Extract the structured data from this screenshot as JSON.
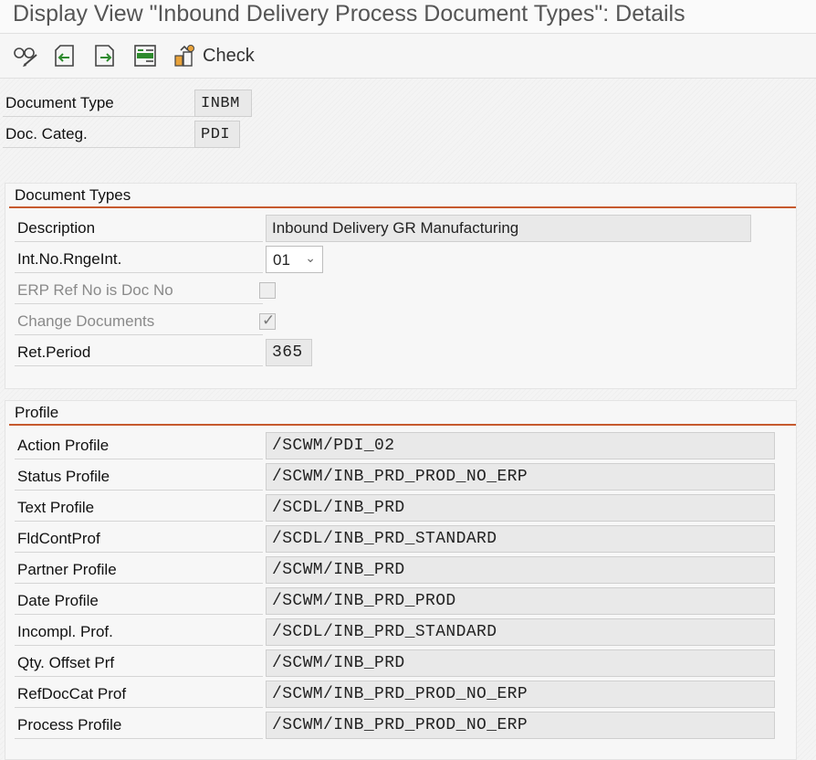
{
  "window": {
    "title": "Display View \"Inbound Delivery Process Document Types\": Details"
  },
  "toolbar": {
    "check_label": "Check",
    "icons": [
      "display-change-icon",
      "previous-entry-icon",
      "next-entry-icon",
      "select-block-icon",
      "check-icon"
    ]
  },
  "header": {
    "document_type": {
      "label": "Document Type",
      "value": "INBM"
    },
    "doc_categ": {
      "label": "Doc. Categ.",
      "value": "PDI"
    }
  },
  "document_types": {
    "title": "Document Types",
    "description": {
      "label": "Description",
      "value": "Inbound Delivery GR Manufacturing"
    },
    "int_no_range": {
      "label": "Int.No.RngeInt.",
      "value": "01"
    },
    "erp_ref": {
      "label": "ERP Ref No is Doc No",
      "checked": false
    },
    "change_docs": {
      "label": "Change Documents",
      "checked": true
    },
    "ret_period": {
      "label": "Ret.Period",
      "value": "365"
    }
  },
  "profile": {
    "title": "Profile",
    "rows": [
      {
        "label": "Action Profile",
        "value": "/SCWM/PDI_02"
      },
      {
        "label": "Status Profile",
        "value": "/SCWM/INB_PRD_PROD_NO_ERP"
      },
      {
        "label": "Text Profile",
        "value": "/SCDL/INB_PRD"
      },
      {
        "label": "FldContProf",
        "value": "/SCDL/INB_PRD_STANDARD"
      },
      {
        "label": "Partner Profile",
        "value": "/SCWM/INB_PRD"
      },
      {
        "label": "Date Profile",
        "value": "/SCWM/INB_PRD_PROD"
      },
      {
        "label": "Incompl. Prof.",
        "value": "/SCDL/INB_PRD_STANDARD"
      },
      {
        "label": "Qty. Offset Prf",
        "value": "/SCWM/INB_PRD"
      },
      {
        "label": "RefDocCat Prof",
        "value": "/SCWM/INB_PRD_PROD_NO_ERP"
      },
      {
        "label": "Process Profile",
        "value": "/SCWM/INB_PRD_PROD_NO_ERP"
      }
    ]
  },
  "colors": {
    "accent": "#c65a2e",
    "field_bg": "#e9e9e9"
  }
}
